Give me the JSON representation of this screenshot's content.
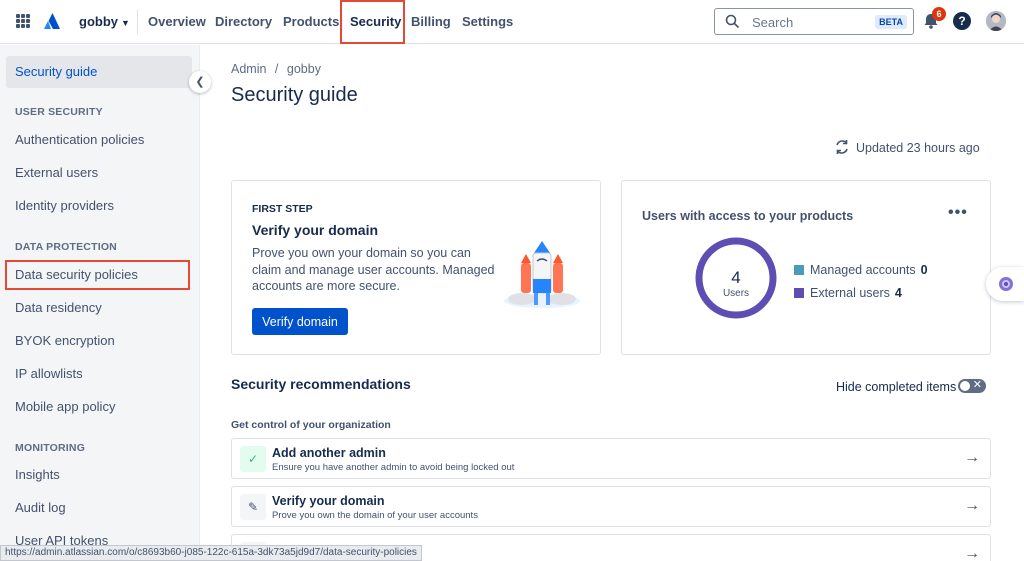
{
  "topnav": {
    "org_name": "gobby",
    "items": [
      "Overview",
      "Directory",
      "Products",
      "Security",
      "Billing",
      "Settings"
    ],
    "active": "Security",
    "search_placeholder": "Search",
    "search_badge": "BETA",
    "notification_count": "6",
    "help_label": "?"
  },
  "sidebar": {
    "top_item": "Security guide",
    "sections": [
      {
        "heading": "USER SECURITY",
        "items": [
          "Authentication policies",
          "External users",
          "Identity providers"
        ]
      },
      {
        "heading": "DATA PROTECTION",
        "items": [
          "Data security policies",
          "Data residency",
          "BYOK encryption",
          "IP allowlists",
          "Mobile app policy"
        ]
      },
      {
        "heading": "MONITORING",
        "items": [
          "Insights",
          "Audit log",
          "User API tokens"
        ]
      }
    ]
  },
  "main": {
    "breadcrumb": [
      "Admin",
      "/",
      "gobby"
    ],
    "title": "Security guide",
    "updated": "Updated 23 hours ago",
    "first_step": {
      "eyebrow": "FIRST STEP",
      "title": "Verify your domain",
      "description": "Prove you own your domain so you can claim and manage user accounts. Managed accounts are more secure.",
      "button": "Verify domain"
    },
    "users_card": {
      "title": "Users with access to your products",
      "more": "•••",
      "total": "4",
      "total_label": "Users",
      "legend": [
        {
          "label": "Managed accounts",
          "count": "0",
          "color": "#4c9aba"
        },
        {
          "label": "External users",
          "count": "4",
          "color": "#5e4db2"
        }
      ]
    },
    "recommendations": {
      "title": "Security recommendations",
      "hide_completed": "Hide completed items",
      "group": "Get control of your organization",
      "rows": [
        {
          "title": "Add another admin",
          "subtitle": "Ensure you have another admin to avoid being locked out",
          "icon": "check-icon"
        },
        {
          "title": "Verify your domain",
          "subtitle": "Prove you own the domain of your user accounts",
          "icon": "pencil-icon"
        }
      ]
    }
  },
  "status_bar": {
    "url": "https://admin.atlassian.com/o/c8693b60-j085-122c-615a-3dk73a5jd9d7/data-security-policies"
  }
}
